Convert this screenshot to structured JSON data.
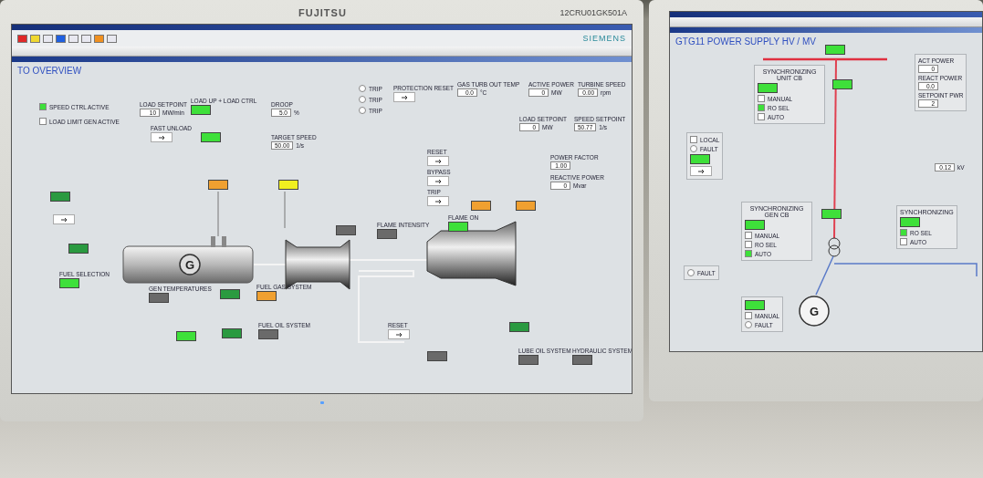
{
  "left_monitor": {
    "brand": "FUJITSU",
    "asset_tag": "12CRU01GK501A",
    "screen": {
      "logo": "SIEMENS",
      "page_title": "TO OVERVIEW",
      "toolbar_swatches": [
        {
          "color": "#e02828"
        },
        {
          "color": "#f0d830"
        },
        {
          "color": "#e8e8f0"
        },
        {
          "color": "#2060e0"
        },
        {
          "color": "#e8e8f0"
        },
        {
          "color": "#e8e8f0"
        },
        {
          "color": "#f09020"
        },
        {
          "color": "#e8e8f0"
        }
      ],
      "generator_symbol": "G",
      "widgets": [
        {
          "kind": "check",
          "label": "SPEED CTRL ACTIVE",
          "checked": true
        },
        {
          "kind": "check",
          "label": "LOAD LIMIT GEN ACTIVE",
          "checked": false
        },
        {
          "kind": "field",
          "label": "LOAD SETPOINT",
          "value": "10",
          "unit": "MW/min"
        },
        {
          "kind": "status",
          "label": "LOAD UP + LOAD CTRL",
          "color": "#3ee03a"
        },
        {
          "kind": "field",
          "label": "DROOP",
          "value": "5.0",
          "unit": "%"
        },
        {
          "kind": "button",
          "label": "FAST UNLOAD"
        },
        {
          "kind": "status",
          "color": "#3ee03a"
        },
        {
          "kind": "field",
          "label": "TARGET SPEED",
          "value": "50.00",
          "unit": "1/s"
        },
        {
          "kind": "radio",
          "label": "TRIP",
          "selected": false
        },
        {
          "kind": "radio",
          "label": "TRIP",
          "selected": false
        },
        {
          "kind": "radio",
          "label": "TRIP",
          "selected": false
        },
        {
          "kind": "button",
          "label": "PROTECTION RESET"
        },
        {
          "kind": "field",
          "label": "GAS TURB OUT TEMP",
          "value": "0.0",
          "unit": "°C"
        },
        {
          "kind": "field",
          "label": "ACTIVE POWER",
          "value": "0",
          "unit": "MW"
        },
        {
          "kind": "field",
          "label": "TURBINE SPEED",
          "value": "0.00",
          "unit": "rpm"
        },
        {
          "kind": "field",
          "label": "LOAD SETPOINT",
          "value": "0",
          "unit": "MW"
        },
        {
          "kind": "field",
          "label": "SPEED SETPOINT",
          "value": "50.77",
          "unit": "1/s"
        },
        {
          "kind": "button",
          "label": "RESET"
        },
        {
          "kind": "button",
          "label": "BYPASS"
        },
        {
          "kind": "button",
          "label": "TRIP"
        },
        {
          "kind": "field",
          "label": "POWER FACTOR",
          "value": "1.00"
        },
        {
          "kind": "field",
          "label": "REACTIVE POWER",
          "value": "0",
          "unit": "Mvar"
        },
        {
          "kind": "status",
          "color": "#f0a030"
        },
        {
          "kind": "status",
          "color": "#f0a030"
        },
        {
          "kind": "status",
          "label": "FLAME ON",
          "color": "#3ee03a"
        },
        {
          "kind": "status",
          "label": "FLAME INTENSITY",
          "color": "#6a6a6a"
        },
        {
          "kind": "status",
          "color": "#6a6a6a"
        },
        {
          "kind": "status",
          "color": "#f0a030"
        },
        {
          "kind": "status",
          "color": "#f0f020"
        },
        {
          "kind": "status",
          "color": "#2a9a40"
        },
        {
          "kind": "button"
        },
        {
          "kind": "status",
          "color": "#2a9a40"
        },
        {
          "kind": "status",
          "label": "FUEL SELECTION",
          "color": "#3ee03a"
        },
        {
          "kind": "status",
          "label": "GEN TEMPERATURES",
          "color": "#6a6a6a"
        },
        {
          "kind": "status",
          "color": "#2a9a40"
        },
        {
          "kind": "status",
          "label": "FUEL GAS SYSTEM",
          "color": "#f0a030"
        },
        {
          "kind": "status",
          "color": "#3ee03a"
        },
        {
          "kind": "status",
          "color": "#2a9a40"
        },
        {
          "kind": "status",
          "label": "FUEL OIL SYSTEM",
          "color": "#6a6a6a"
        },
        {
          "kind": "button",
          "label": "RESET"
        },
        {
          "kind": "status",
          "color": "#2a9a40"
        },
        {
          "kind": "status",
          "color": "#6a6a6a"
        },
        {
          "kind": "status",
          "label": "LUBE OIL SYSTEM",
          "color": "#6a6a6a"
        },
        {
          "kind": "status",
          "label": "HYDRAULIC SYSTEM",
          "color": "#6a6a6a"
        }
      ]
    }
  },
  "right_monitor": {
    "screen": {
      "page_title": "GTG11 POWER SUPPLY HV / MV",
      "generator_symbol": "G",
      "panels": [
        {
          "title": "SYNCHRONIZING UNIT CB",
          "items": [
            {
              "kind": "status",
              "color": "#3ee03a"
            },
            {
              "kind": "check",
              "label": "MANUAL",
              "checked": false
            },
            {
              "kind": "check",
              "label": "RO SEL",
              "checked": true
            },
            {
              "kind": "check",
              "label": "AUTO",
              "checked": false
            }
          ]
        },
        {
          "items": [
            {
              "kind": "check",
              "label": "LOCAL",
              "checked": false
            },
            {
              "kind": "radio",
              "label": "FAULT",
              "selected": false
            },
            {
              "kind": "status",
              "color": "#3ee03a"
            },
            {
              "kind": "button"
            }
          ]
        },
        {
          "items": [
            {
              "kind": "field",
              "label": "ACT POWER",
              "value": "0"
            },
            {
              "kind": "field",
              "label": "REACT POWER",
              "value": "0.0"
            },
            {
              "kind": "field",
              "label": "SETPOINT PWR",
              "value": "2"
            }
          ]
        },
        {
          "title": "SYNCHRONIZING GEN CB",
          "items": [
            {
              "kind": "status",
              "color": "#3ee03a"
            },
            {
              "kind": "check",
              "label": "MANUAL",
              "checked": false
            },
            {
              "kind": "check",
              "label": "RO SEL",
              "checked": false
            },
            {
              "kind": "check",
              "label": "AUTO",
              "checked": true
            }
          ]
        },
        {
          "items": [
            {
              "kind": "radio",
              "label": "FAULT",
              "selected": false
            }
          ]
        },
        {
          "items": [
            {
              "kind": "status",
              "color": "#3ee03a"
            },
            {
              "kind": "check",
              "label": "MANUAL",
              "checked": false
            },
            {
              "kind": "radio",
              "label": "FAULT",
              "selected": false
            }
          ]
        },
        {
          "title": "SYNCHRONIZING",
          "items": [
            {
              "kind": "status",
              "color": "#3ee03a"
            },
            {
              "kind": "check",
              "label": "RO SEL",
              "checked": true
            },
            {
              "kind": "check",
              "label": "AUTO",
              "checked": false
            }
          ]
        }
      ],
      "widgets": [
        {
          "kind": "status",
          "color": "#3ee03a"
        },
        {
          "kind": "status",
          "color": "#3ee03a"
        },
        {
          "kind": "status",
          "color": "#3ee03a"
        },
        {
          "kind": "field",
          "value": "0.12",
          "unit": "kV"
        }
      ]
    }
  }
}
